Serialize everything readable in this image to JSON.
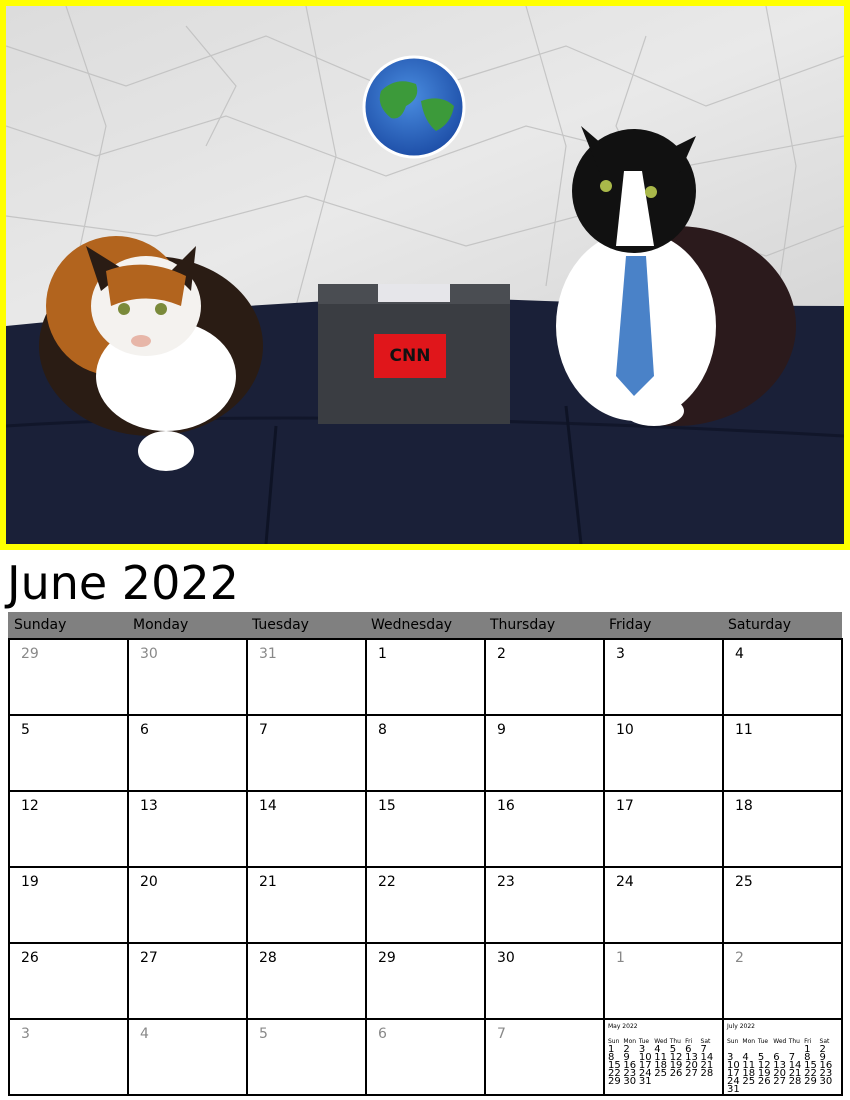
{
  "title": "June 2022",
  "photo": {
    "sign_text": "CNN"
  },
  "weekdays": [
    "Sunday",
    "Monday",
    "Tuesday",
    "Wednesday",
    "Thursday",
    "Friday",
    "Saturday"
  ],
  "weeks": [
    [
      {
        "d": "29",
        "m": true
      },
      {
        "d": "30",
        "m": true
      },
      {
        "d": "31",
        "m": true
      },
      {
        "d": "1"
      },
      {
        "d": "2"
      },
      {
        "d": "3"
      },
      {
        "d": "4"
      }
    ],
    [
      {
        "d": "5"
      },
      {
        "d": "6"
      },
      {
        "d": "7"
      },
      {
        "d": "8"
      },
      {
        "d": "9"
      },
      {
        "d": "10"
      },
      {
        "d": "11"
      }
    ],
    [
      {
        "d": "12"
      },
      {
        "d": "13"
      },
      {
        "d": "14"
      },
      {
        "d": "15"
      },
      {
        "d": "16"
      },
      {
        "d": "17"
      },
      {
        "d": "18"
      }
    ],
    [
      {
        "d": "19"
      },
      {
        "d": "20"
      },
      {
        "d": "21"
      },
      {
        "d": "22"
      },
      {
        "d": "23"
      },
      {
        "d": "24"
      },
      {
        "d": "25"
      }
    ],
    [
      {
        "d": "26"
      },
      {
        "d": "27"
      },
      {
        "d": "28"
      },
      {
        "d": "29"
      },
      {
        "d": "30"
      },
      {
        "d": "1",
        "m": true
      },
      {
        "d": "2",
        "m": true
      }
    ],
    [
      {
        "d": "3",
        "m": true
      },
      {
        "d": "4",
        "m": true
      },
      {
        "d": "5",
        "m": true
      },
      {
        "d": "6",
        "m": true
      },
      {
        "d": "7",
        "m": true
      },
      {
        "mini": 0
      },
      {
        "mini": 1
      }
    ]
  ],
  "minis": [
    {
      "title": "May 2022",
      "days": [
        "Sun",
        "Mon",
        "Tue",
        "Wed",
        "Thu",
        "Fri",
        "Sat"
      ],
      "rows": [
        [
          "1",
          "2",
          "3",
          "4",
          "5",
          "6",
          "7"
        ],
        [
          "8",
          "9",
          "10",
          "11",
          "12",
          "13",
          "14"
        ],
        [
          "15",
          "16",
          "17",
          "18",
          "19",
          "20",
          "21"
        ],
        [
          "22",
          "23",
          "24",
          "25",
          "26",
          "27",
          "28"
        ],
        [
          "29",
          "30",
          "31",
          "",
          "",
          "",
          ""
        ]
      ]
    },
    {
      "title": "July 2022",
      "days": [
        "Sun",
        "Mon",
        "Tue",
        "Wed",
        "Thu",
        "Fri",
        "Sat"
      ],
      "rows": [
        [
          "",
          "",
          "",
          "",
          "",
          "1",
          "2"
        ],
        [
          "3",
          "4",
          "5",
          "6",
          "7",
          "8",
          "9"
        ],
        [
          "10",
          "11",
          "12",
          "13",
          "14",
          "15",
          "16"
        ],
        [
          "17",
          "18",
          "19",
          "20",
          "21",
          "22",
          "23"
        ],
        [
          "24",
          "25",
          "26",
          "27",
          "28",
          "29",
          "30"
        ],
        [
          "31",
          "",
          "",
          "",
          "",
          "",
          ""
        ]
      ]
    }
  ],
  "colors": {
    "photo_border": "#ffff00",
    "header_bg": "#808080",
    "muted_text": "#888888"
  }
}
